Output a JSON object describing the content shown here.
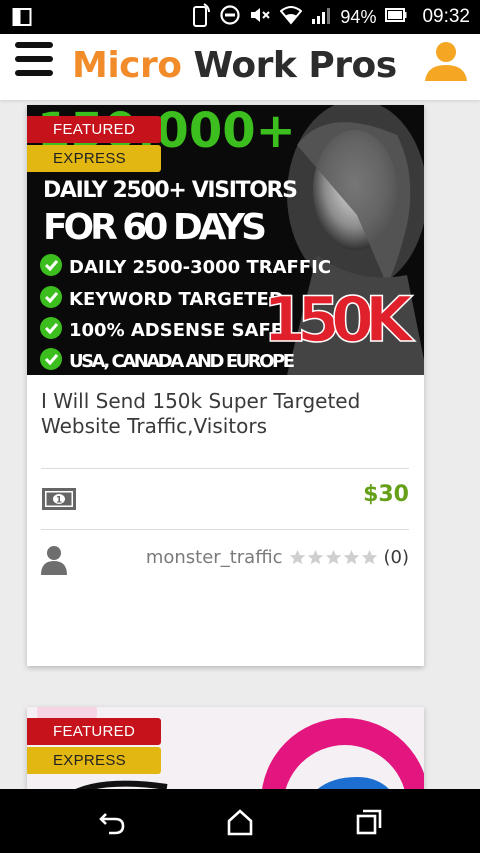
{
  "status_bar": {
    "battery": "94%",
    "time": "09:32",
    "icons": [
      "device-orientation-icon",
      "nfc-phone-icon",
      "do-not-disturb-icon",
      "mute-icon",
      "wifi-icon",
      "cell-signal-icon",
      "battery-icon"
    ]
  },
  "header": {
    "logo_word1": "Micro",
    "logo_word2": "Work",
    "logo_word3": "Pros",
    "icons": [
      "menu-icon",
      "user-icon"
    ],
    "colors": {
      "brand_orange": "#f28c2a",
      "dark": "#2c2c2c"
    }
  },
  "card1": {
    "badge_featured": "FEATURED",
    "badge_express": "EXPRESS",
    "image_headline_big": "150,000+",
    "image_line1": "DAILY 2500+ VISITORS",
    "image_line2": "FOR 60 DAYS",
    "image_bullets": [
      "DAILY 2500-3000 TRAFFIC",
      "KEYWORD TARGETED",
      "100% ADSENSE SAFE",
      "USA, CANADA AND EUROPE"
    ],
    "image_tag": "150K",
    "title": "I Will Send 150k Super Targeted Website Traffic,Visitors",
    "price": "$30",
    "seller": "monster_traffic",
    "rating_stars": 0,
    "rating_count": "(0)",
    "colors": {
      "featured": "#c5121b",
      "express": "#e3b711",
      "price": "#66a019"
    }
  },
  "card2": {
    "badge_featured": "FEATURED",
    "badge_express": "EXPRESS"
  },
  "nav": {
    "icons": [
      "back-icon",
      "home-icon",
      "recents-icon"
    ]
  }
}
